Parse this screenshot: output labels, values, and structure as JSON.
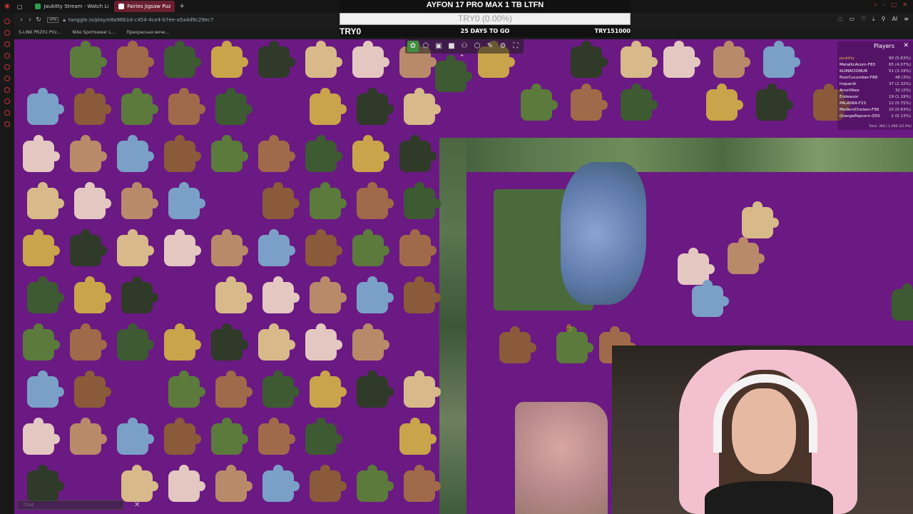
{
  "browser": {
    "tabs": [
      {
        "label": "Jaukitty Stream - Watch Li",
        "icon_color": "#2e9e4f",
        "active": false
      },
      {
        "label": "Fairies Jigsaw Puz",
        "icon_color": "#ffffff",
        "active": true
      }
    ],
    "new_tab_label": "+",
    "url": "tanggle.io/play/e8a96b1d-c454-4ce4-b7ee-a5a4d9c29ec7",
    "vpn_label": "VPN",
    "bookmarks": [
      "S-LINK PRZ01 Priz...",
      "Nike Sportswear L...",
      "Прекрасная вече..."
    ]
  },
  "goal": {
    "title": "AYFON 17 PRO MAX 1 TB LTFN",
    "percent_label": "TRY0 (0.00%)",
    "progress_fraction": 0,
    "current": "TRY0",
    "days_left": "25 DAYS TO GO",
    "target": "TRY151000"
  },
  "toolbar": {
    "tools": [
      {
        "name": "puzzle-tool",
        "glyph": "✿",
        "active": true
      },
      {
        "name": "pieces-tool",
        "glyph": "⬠",
        "active": false
      },
      {
        "name": "image-tool",
        "glyph": "▣",
        "active": false
      },
      {
        "name": "color-tool",
        "glyph": "■",
        "active": false
      },
      {
        "name": "players-tool",
        "glyph": "⚇",
        "active": false
      },
      {
        "name": "sort-tool",
        "glyph": "⬡",
        "active": false
      },
      {
        "name": "edit-tool",
        "glyph": "✎",
        "active": false
      },
      {
        "name": "settings-tool",
        "glyph": "⚙",
        "active": false
      },
      {
        "name": "fullscreen-tool",
        "glyph": "⛶",
        "active": false
      }
    ],
    "collapse_glyph": "⌃"
  },
  "players": {
    "title": "Players",
    "close_glyph": "✕",
    "list": [
      {
        "name": "Jaukitty",
        "score": "90 (5.63%)"
      },
      {
        "name": "MetallicAcorn-F83",
        "score": "65 (4.07%)"
      },
      {
        "name": "KLIMACIONUR",
        "score": "51 (3.19%)"
      },
      {
        "name": "PoorCucumber-F88",
        "score": "48 (3%)"
      },
      {
        "name": "hispanik",
        "score": "37 (2.32%)"
      },
      {
        "name": "ArsoVibes",
        "score": "32 (2%)"
      },
      {
        "name": "Endeavor",
        "score": "19 (1.19%)"
      },
      {
        "name": "PALASKA-F23",
        "score": "12 (0.75%)"
      },
      {
        "name": "ModernChicken-F56",
        "score": "10 (0.63%)"
      },
      {
        "name": "OrangePopcorn-Q55",
        "score": "2 (0.13%)"
      }
    ],
    "total": "Total: 366 / 1,598 (22.9%)"
  },
  "chat": {
    "placeholder": "Chat",
    "close_glyph": "✕"
  },
  "colors": {
    "canvas": "#6a1a82",
    "goal_bg": "#111111",
    "accent_active_tool": "#3f8e3f",
    "active_tab": "#6b1f2f"
  },
  "piece_palette": [
    "#5b7a3c",
    "#c9a44a",
    "#e4c7c1",
    "#8a5a3a",
    "#3e5a32",
    "#d8b98a",
    "#7aa0c8",
    "#a06a4a",
    "#2f3a28",
    "#b98a6a"
  ]
}
